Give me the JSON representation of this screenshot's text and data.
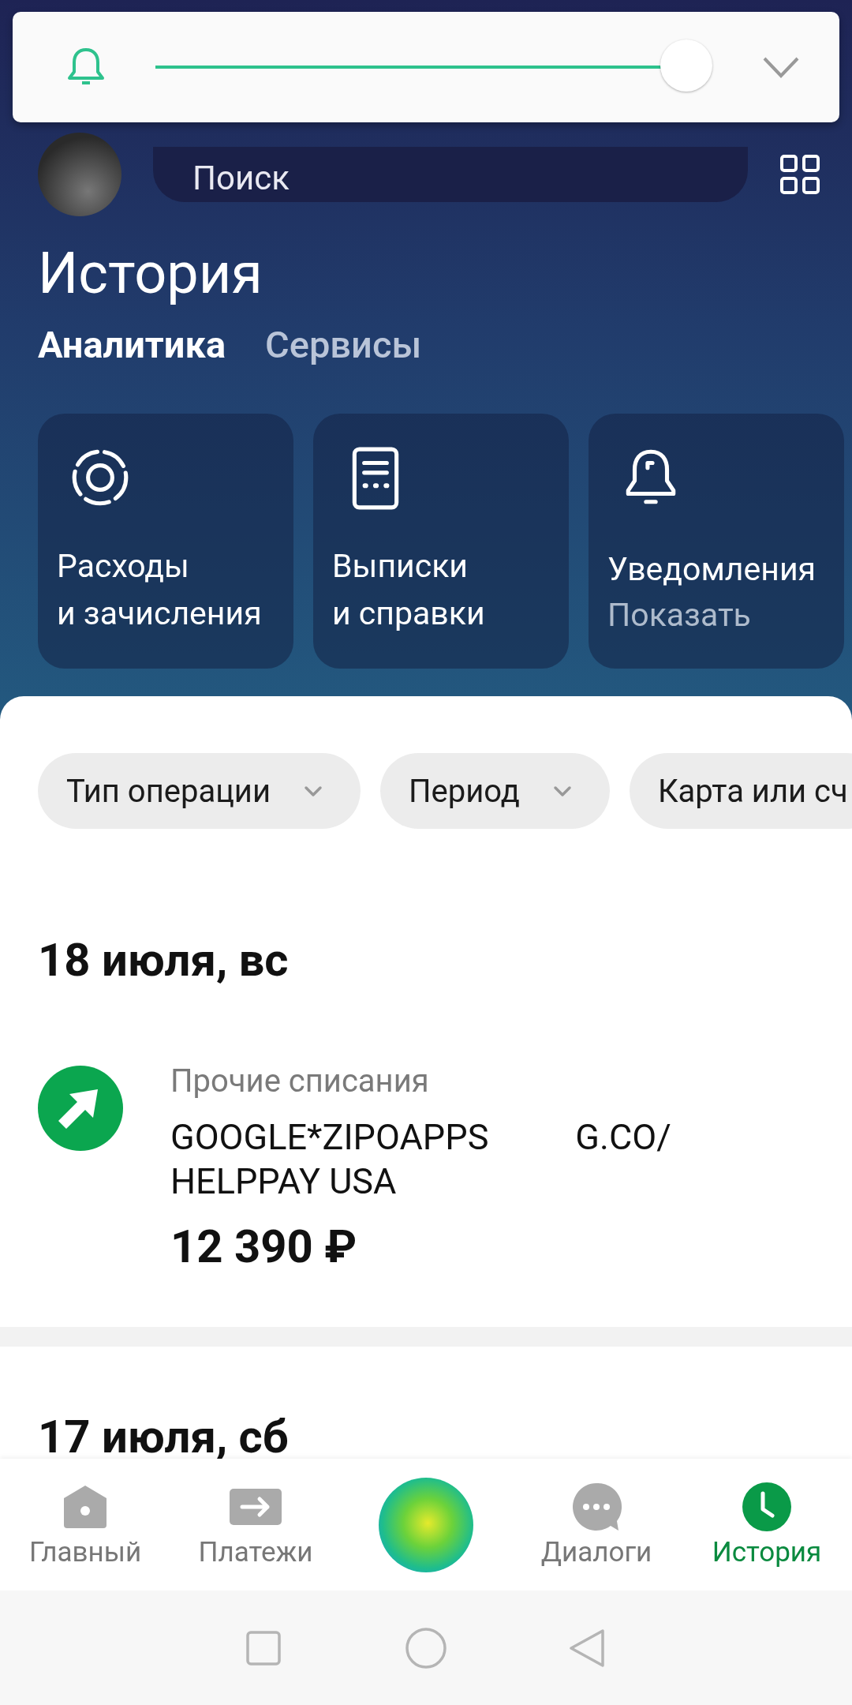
{
  "volume_panel": {
    "level": 1
  },
  "header": {
    "search": {
      "placeholder": "Поиск"
    }
  },
  "title": "История",
  "tabs": [
    {
      "label": "Аналитика",
      "selected": true
    },
    {
      "label": "Сервисы",
      "selected": false
    }
  ],
  "cards": [
    {
      "kind": "expenses",
      "lines": [
        "Расходы",
        "и зачисления"
      ]
    },
    {
      "kind": "statements",
      "lines": [
        "Выписки",
        "и справки"
      ]
    },
    {
      "kind": "notifications",
      "lines": [
        "Уведомления"
      ],
      "action": "Показать"
    }
  ],
  "filters": [
    {
      "label": "Тип операции",
      "dropdown": true
    },
    {
      "label": "Период",
      "dropdown": true
    },
    {
      "label": "Карта или сч",
      "dropdown": false
    }
  ],
  "days": [
    {
      "date": "18 июля, вс",
      "operations": [
        {
          "category": "Прочие списания",
          "merchant": [
            "GOOGLE*ZIPOAPPS",
            "G.CO/",
            "HELPPAY USA"
          ],
          "amount": "12 390 ₽"
        }
      ]
    },
    {
      "date": "17 июля, сб"
    }
  ],
  "bottom_nav": [
    {
      "kind": "home",
      "label": "Главный",
      "selected": false
    },
    {
      "kind": "payments",
      "label": "Платежи",
      "selected": false
    },
    {
      "kind": "assistant"
    },
    {
      "kind": "dialogs",
      "label": "Диалоги",
      "selected": false
    },
    {
      "kind": "history",
      "label": "История",
      "selected": true
    }
  ]
}
